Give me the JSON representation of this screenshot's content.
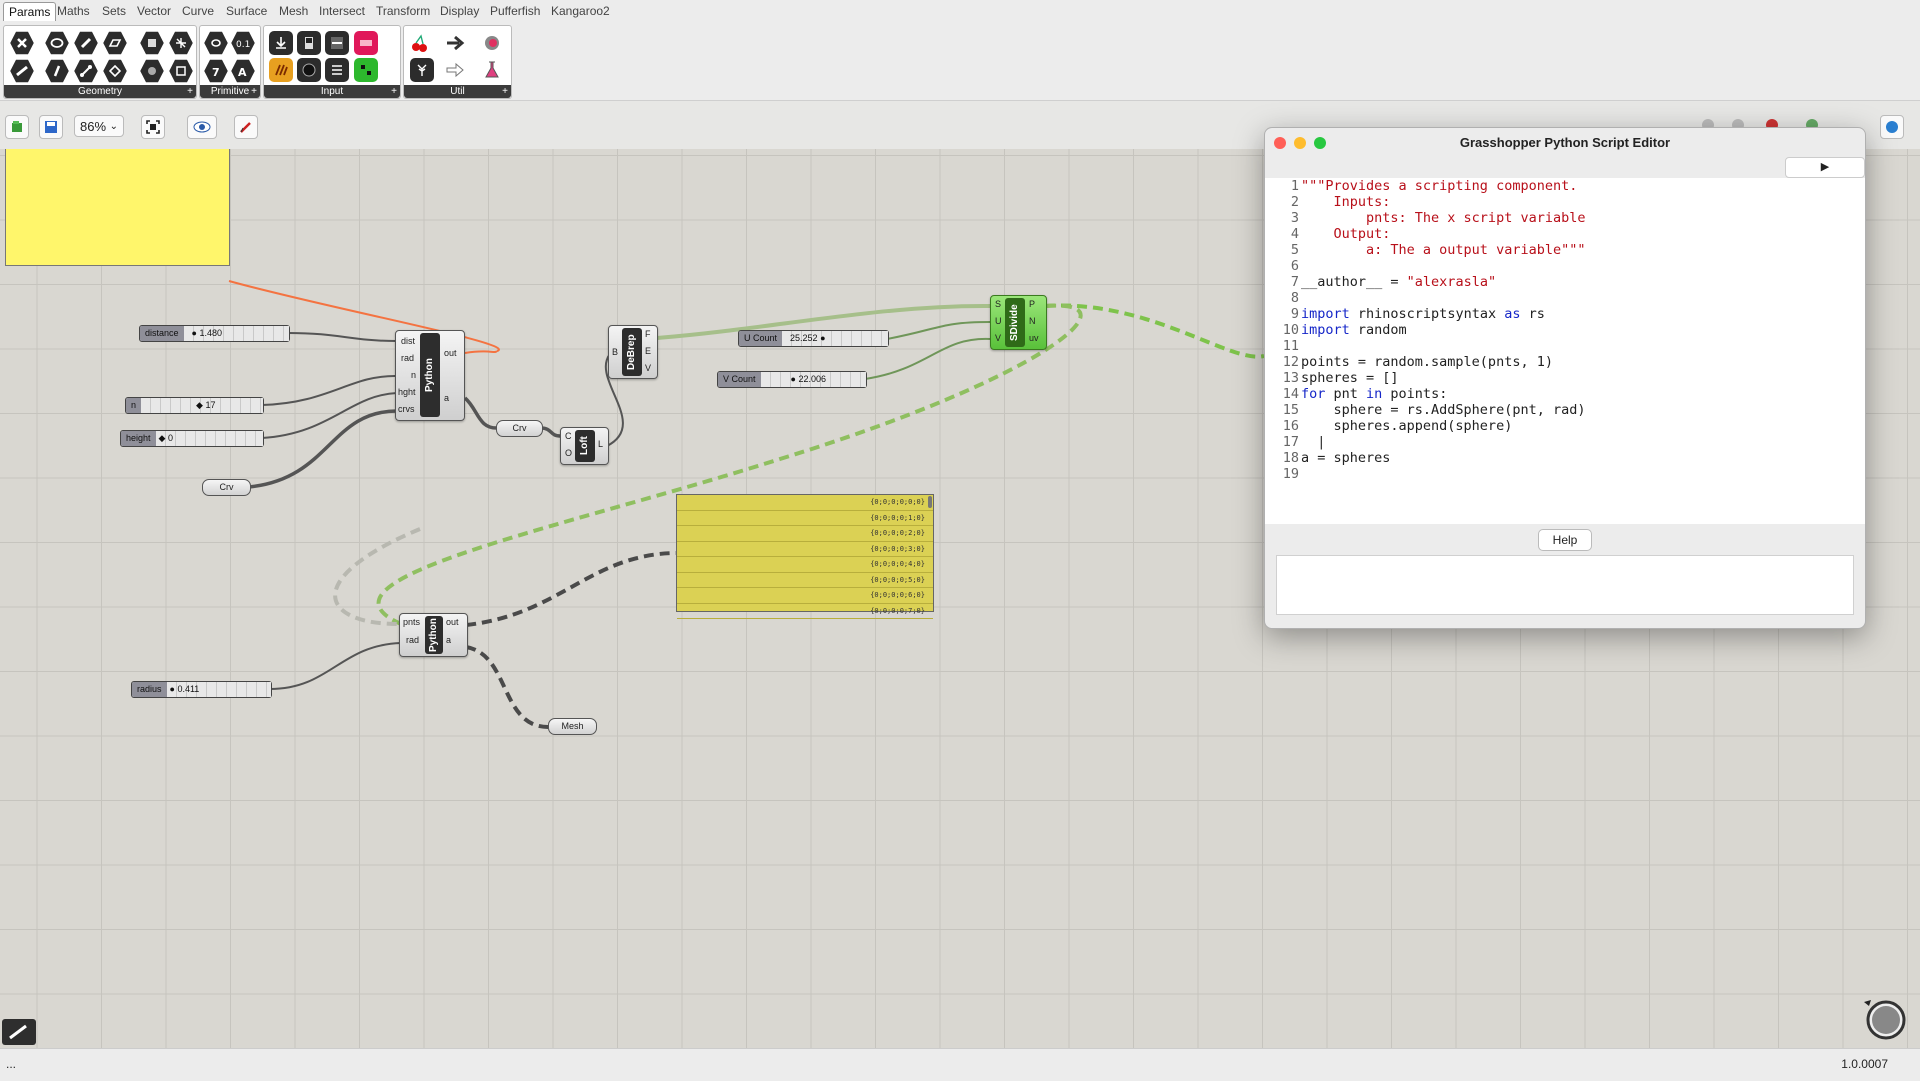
{
  "tabs": [
    "Params",
    "Maths",
    "Sets",
    "Vector",
    "Curve",
    "Surface",
    "Mesh",
    "Intersect",
    "Transform",
    "Display",
    "Pufferfish",
    "Kangaroo2"
  ],
  "ribbon": {
    "groups": [
      "Geometry",
      "Primitive",
      "Input",
      "Util"
    ]
  },
  "toolbar": {
    "zoom": "86%"
  },
  "canvas": {
    "sliders": {
      "distance": {
        "label": "distance",
        "value": "1.480"
      },
      "n": {
        "label": "n",
        "value": "17"
      },
      "height": {
        "label": "height",
        "value": "0"
      },
      "ucount": {
        "label": "U Count",
        "value": "25.252"
      },
      "vcount": {
        "label": "V Count",
        "value": "22.006"
      },
      "radius": {
        "label": "radius",
        "value": "0.411"
      }
    },
    "params": {
      "crv1": "Crv",
      "crv2": "Crv",
      "mesh": "Mesh"
    },
    "python1": {
      "name": "Python",
      "inputs": [
        "dist",
        "rad",
        "n",
        "hght",
        "crvs"
      ],
      "outputs": [
        "out",
        "a"
      ]
    },
    "python2": {
      "name": "Python",
      "inputs": [
        "pnts",
        "rad"
      ],
      "outputs": [
        "out",
        "a"
      ]
    },
    "debrep": {
      "name": "DeBrep",
      "inputs": [
        "B"
      ],
      "outputs": [
        "F",
        "E",
        "V"
      ]
    },
    "loft": {
      "name": "Loft",
      "inputs": [
        "C",
        "O"
      ],
      "outputs": [
        "L"
      ]
    },
    "sdivide": {
      "name": "SDivide",
      "inputs": [
        "S",
        "U",
        "V"
      ],
      "outputs": [
        "P",
        "N",
        "uv"
      ]
    },
    "panel_rows": [
      "{0;0;0;0;0;0}",
      "{0;0;0;0;1;0}",
      "{0;0;0;0;2;0}",
      "{0;0;0;0;3;0}",
      "{0;0;0;0;4;0}",
      "{0;0;0;0;5;0}",
      "{0;0;0;0;6;0}",
      "{0;0;0;0;7;0}"
    ]
  },
  "editor": {
    "title": "Grasshopper Python Script Editor",
    "run_glyph": "▶",
    "help_label": "Help",
    "code": [
      {
        "n": "1",
        "parts": [
          {
            "t": "\"\"\"Provides a scripting component.",
            "c": "str"
          }
        ]
      },
      {
        "n": "2",
        "parts": [
          {
            "t": "    Inputs:",
            "c": "str"
          }
        ]
      },
      {
        "n": "3",
        "parts": [
          {
            "t": "        pnts: The x script variable",
            "c": "str"
          }
        ]
      },
      {
        "n": "4",
        "parts": [
          {
            "t": "    Output:",
            "c": "str"
          }
        ]
      },
      {
        "n": "5",
        "parts": [
          {
            "t": "        a: The a output variable\"\"\"",
            "c": "str"
          }
        ]
      },
      {
        "n": "6",
        "parts": []
      },
      {
        "n": "7",
        "parts": [
          {
            "t": "__author__ = ",
            "c": ""
          },
          {
            "t": "\"alexrasla\"",
            "c": "str"
          }
        ]
      },
      {
        "n": "8",
        "parts": []
      },
      {
        "n": "9",
        "parts": [
          {
            "t": "import",
            "c": "kw"
          },
          {
            "t": " rhinoscriptsyntax ",
            "c": ""
          },
          {
            "t": "as",
            "c": "kw"
          },
          {
            "t": " rs",
            "c": ""
          }
        ]
      },
      {
        "n": "10",
        "parts": [
          {
            "t": "import",
            "c": "kw"
          },
          {
            "t": " random",
            "c": ""
          }
        ]
      },
      {
        "n": "11",
        "parts": []
      },
      {
        "n": "12",
        "parts": [
          {
            "t": "points = random.sample(pnts, 1)",
            "c": ""
          }
        ]
      },
      {
        "n": "13",
        "parts": [
          {
            "t": "spheres = []",
            "c": ""
          }
        ]
      },
      {
        "n": "14",
        "parts": [
          {
            "t": "for",
            "c": "kw"
          },
          {
            "t": " pnt ",
            "c": ""
          },
          {
            "t": "in",
            "c": "kw"
          },
          {
            "t": " points:",
            "c": ""
          }
        ]
      },
      {
        "n": "15",
        "parts": [
          {
            "t": "    sphere = rs.AddSphere(pnt, rad)",
            "c": ""
          }
        ]
      },
      {
        "n": "16",
        "parts": [
          {
            "t": "    spheres.append(sphere)",
            "c": ""
          }
        ]
      },
      {
        "n": "17",
        "parts": [
          {
            "t": "  |",
            "c": ""
          }
        ]
      },
      {
        "n": "18",
        "parts": [
          {
            "t": "a = spheres",
            "c": ""
          }
        ]
      },
      {
        "n": "19",
        "parts": []
      }
    ]
  },
  "status": {
    "left": "...",
    "version": "1.0.0007"
  }
}
